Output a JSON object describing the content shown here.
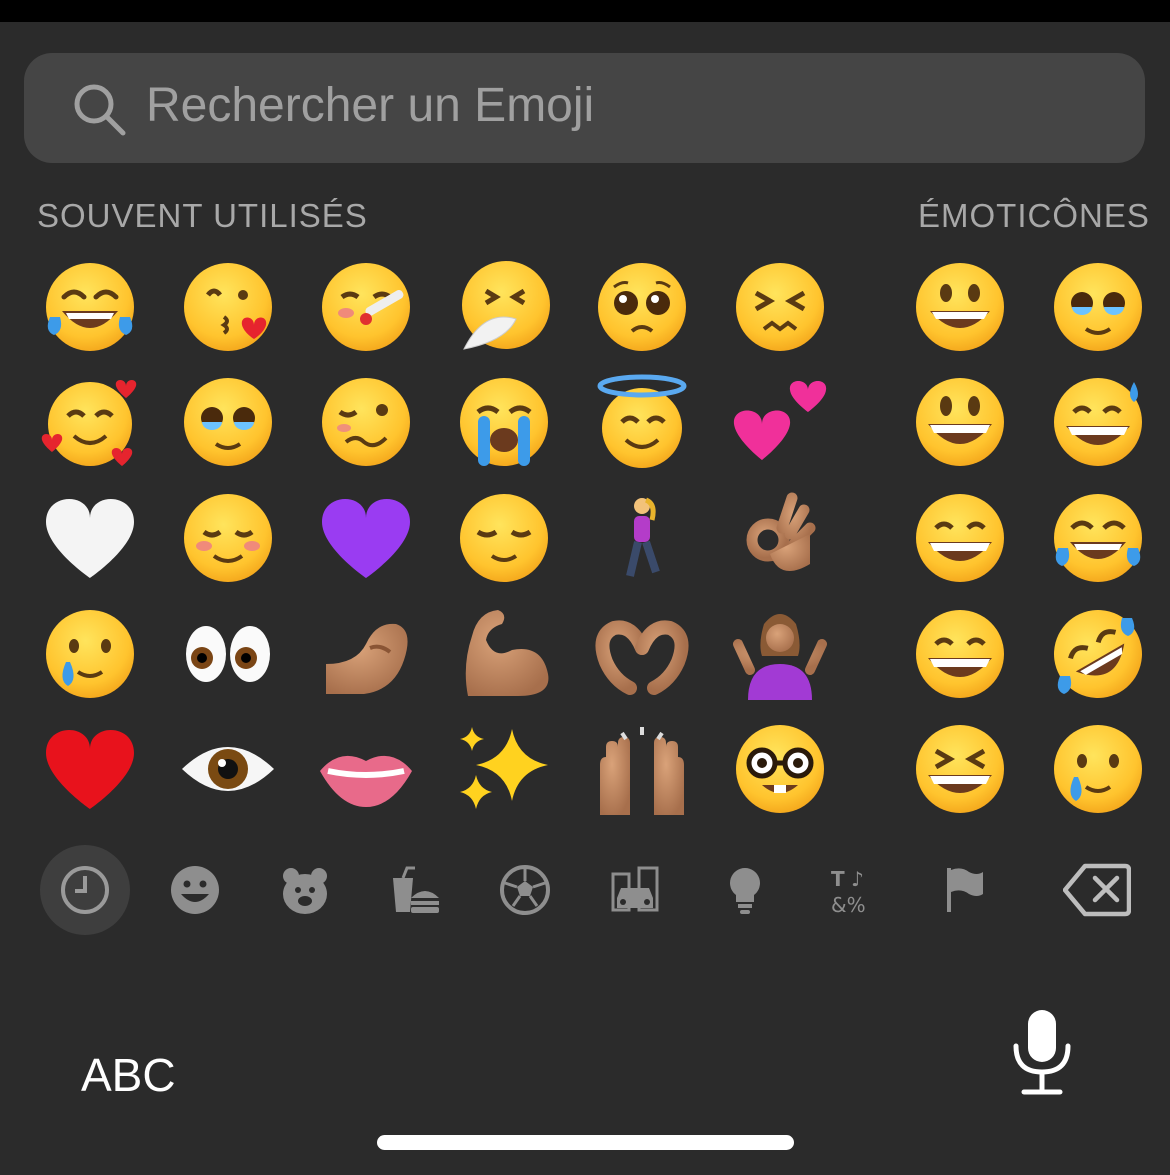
{
  "search": {
    "placeholder": "Rechercher un Emoji"
  },
  "sections": {
    "frequent_label": "SOUVENT UTILISÉS",
    "smileys_label": "ÉMOTICÔNES"
  },
  "frequent": [
    [
      "face-with-tears-of-joy",
      "face-blowing-a-kiss",
      "face-with-thermometer",
      "sneezing-face",
      "pleading-face",
      "confounded-face"
    ],
    [
      "smiling-face-with-hearts",
      "face-holding-back-tears",
      "woozy-face",
      "loudly-crying-face",
      "smiling-face-with-halo",
      "two-hearts"
    ],
    [
      "white-heart",
      "smiling-face",
      "purple-heart",
      "relieved-face",
      "woman-walking",
      "ok-hand"
    ],
    [
      "face-holding-back-tears-smiling",
      "eyes",
      "pinching-hand",
      "flexed-biceps",
      "heart-hands",
      "woman-shrugging"
    ],
    [
      "red-heart",
      "eye",
      "biting-lip",
      "sparkles",
      "raising-hands",
      "nerd-face"
    ]
  ],
  "smileys": [
    [
      "grinning-face",
      "pleading-face"
    ],
    [
      "smiley-face",
      "grinning-face-with-sweat"
    ],
    [
      "beaming-face",
      "face-with-tears-of-joy"
    ],
    [
      "beaming-face",
      "rolling-on-the-floor-laughing"
    ],
    [
      "grinning-squinting-face",
      "smiling-face-with-tear"
    ]
  ],
  "categories": [
    "recent",
    "smileys",
    "animals",
    "food",
    "activity",
    "travel",
    "objects",
    "symbols",
    "flags"
  ],
  "active_category": "recent",
  "keyboard": {
    "abc_label": "ABC"
  },
  "colors": {
    "background": "#2b2b2b",
    "search_bg": "#454545",
    "label": "#a8a8a8",
    "accent": "#ffffff"
  }
}
